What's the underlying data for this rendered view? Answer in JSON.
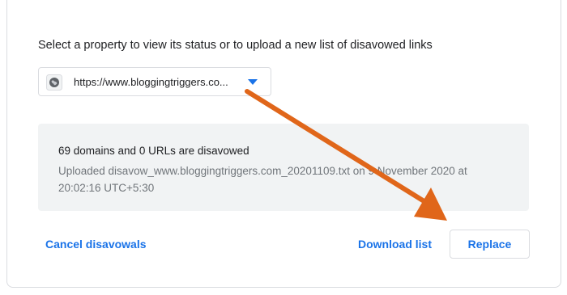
{
  "disavow_panel": {
    "prompt": "Select a property to view its status or to upload a new list of disavowed links",
    "property_select": {
      "selected": "https://www.bloggingtriggers.co...",
      "icon": "globe-icon",
      "dropdown_icon": "caret-down-icon"
    },
    "status": {
      "summary": "69 domains and 0 URLs are disavowed",
      "detail": "Uploaded disavow_www.bloggingtriggers.com_20201109.txt on 9 November 2020 at 20:02:16 UTC+5:30"
    },
    "actions": {
      "cancel": "Cancel disavowals",
      "download": "Download list",
      "replace": "Replace"
    }
  },
  "annotation": {
    "type": "arrow",
    "color": "#e0661a"
  },
  "colors": {
    "link": "#1a73e8",
    "status_bg": "#f1f3f4",
    "text_primary": "#202124",
    "text_secondary": "#70757a"
  }
}
